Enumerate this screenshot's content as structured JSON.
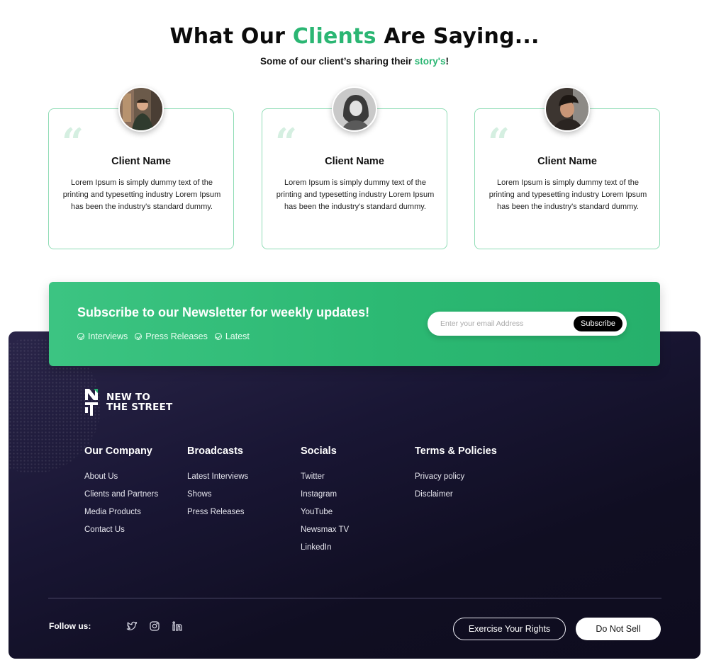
{
  "testimonials": {
    "title_pre": "What Our ",
    "title_accent": "Clients",
    "title_post": " Are Saying...",
    "subtitle_pre": "Some of our client’s sharing their ",
    "subtitle_accent": "story's",
    "subtitle_post": "!",
    "cards": [
      {
        "name": "Client Name",
        "text": "Lorem Ipsum is simply dummy text of the printing and typesetting industry Lorem Ipsum has been the industry's standard dummy.",
        "quote": "“"
      },
      {
        "name": "Client Name",
        "text": "Lorem Ipsum is simply dummy text of the printing and typesetting industry Lorem Ipsum has been the industry's standard dummy.",
        "quote": "“"
      },
      {
        "name": "Client Name",
        "text": "Lorem Ipsum is simply dummy text of the printing and typesetting industry Lorem Ipsum has been the industry's standard dummy.",
        "quote": "“"
      }
    ]
  },
  "newsletter": {
    "title": "Subscribe to our Newsletter for weekly updates!",
    "tags": [
      "Interviews",
      "Press Releases",
      "Latest"
    ],
    "email_placeholder": "Enter your email Address",
    "subscribe_label": "Subscribe"
  },
  "footer": {
    "logo_line1": "NEW TO",
    "logo_line2": "THE STREET",
    "columns": [
      {
        "title": "Our Company",
        "links": [
          "About Us",
          "Clients and Partners",
          "Media Products",
          "Contact Us"
        ]
      },
      {
        "title": "Broadcasts",
        "links": [
          "Latest Interviews",
          "Shows",
          "Press Releases"
        ]
      },
      {
        "title": "Socials",
        "links": [
          "Twitter",
          "Instagram",
          "YouTube",
          "Newsmax TV",
          "LinkedIn"
        ]
      },
      {
        "title": "Terms & Policies",
        "links": [
          "Privacy policy",
          "Disclaimer"
        ]
      }
    ],
    "follow_label": "Follow us:",
    "social_icons": [
      "twitter-icon",
      "instagram-icon",
      "linkedin-icon"
    ],
    "rights_label": "Exercise Your Rights",
    "do_not_sell_label": "Do Not Sell"
  },
  "colors": {
    "accent": "#2bb673",
    "footer_bg": "#141129",
    "card_border": "#8fdcb5"
  }
}
